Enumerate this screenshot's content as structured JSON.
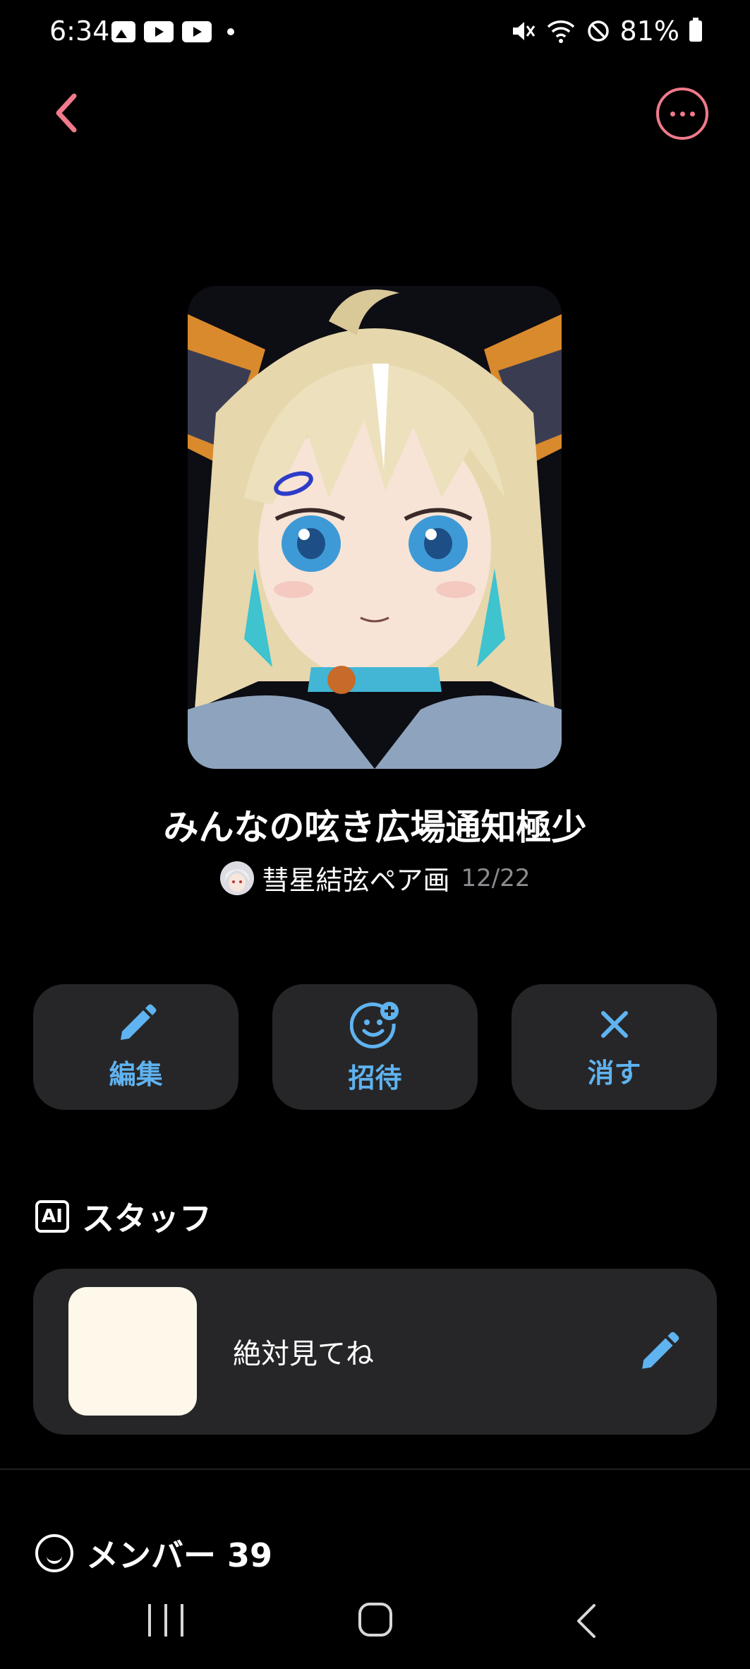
{
  "status_bar": {
    "time": "6:34",
    "battery": "81%",
    "left_icons": [
      "gallery-icon",
      "youtube-icon",
      "youtube-icon",
      "notification-dot"
    ],
    "right_icons": [
      "mute-icon",
      "wifi-icon",
      "do-not-disturb-icon",
      "battery-icon"
    ]
  },
  "header": {
    "back_icon": "chevron-left-icon",
    "more_icon": "more-options-icon",
    "accent_color": "#f07a8a"
  },
  "group": {
    "title": "みんなの呟き広場通知極少",
    "owner_name": "彗星結弦ペア画",
    "date": "12/22"
  },
  "actions": [
    {
      "label": "編集",
      "icon": "pencil-icon"
    },
    {
      "label": "招待",
      "icon": "invite-icon"
    },
    {
      "label": "消す",
      "icon": "close-icon"
    }
  ],
  "staff": {
    "section_title": "スタッフ",
    "badge": "AI",
    "item_name": "絶対見てね",
    "edit_icon": "pencil-icon"
  },
  "members": {
    "section_title": "メンバー 39"
  },
  "colors": {
    "accent_blue": "#5fb3f0",
    "card_bg": "#262628",
    "accent_pink": "#f07a8a"
  }
}
